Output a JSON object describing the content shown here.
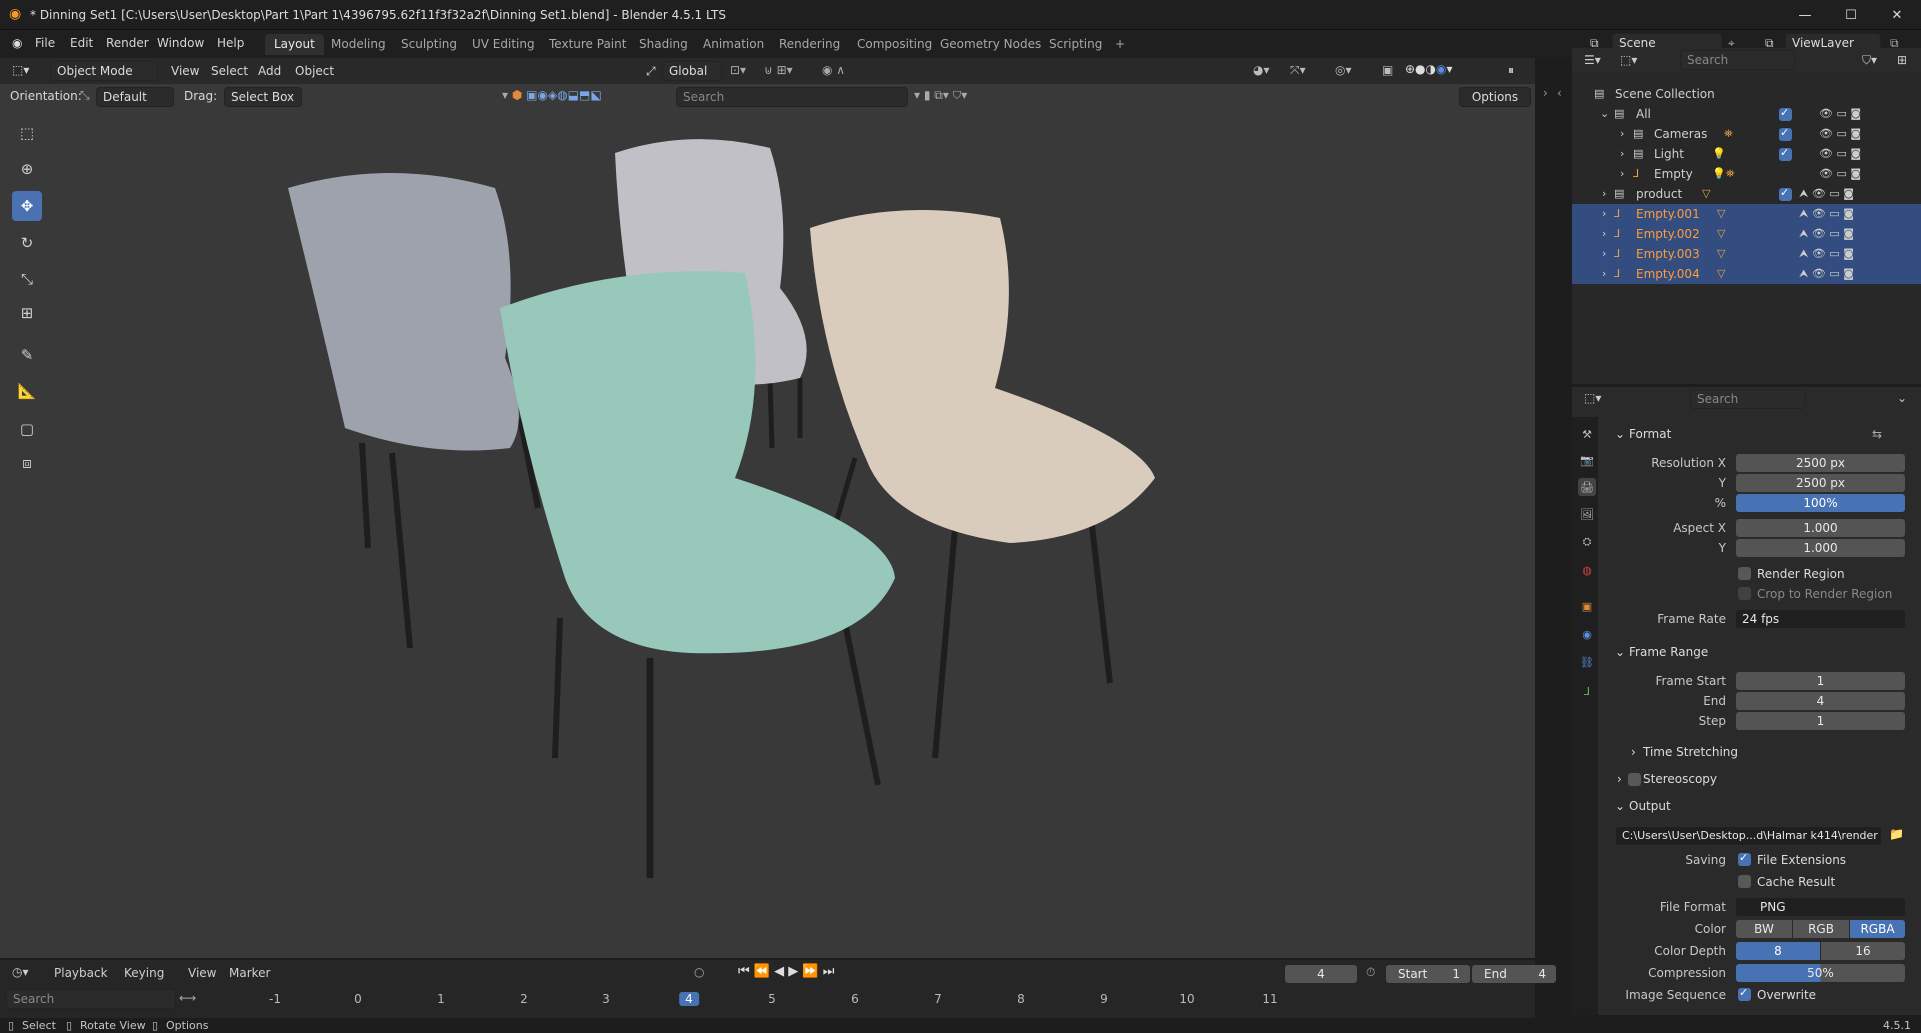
{
  "window": {
    "title": "* Dinning Set1 [C:\\Users\\User\\Desktop\\Part 1\\Part 1\\4396795.62f11f3f32a2f\\Dinning Set1.blend] - Blender 4.5.1 LTS",
    "minimize": "—",
    "maximize": "☐",
    "close": "✕"
  },
  "menu": [
    "File",
    "Edit",
    "Render",
    "Window",
    "Help"
  ],
  "workspaces": [
    "Layout",
    "Modeling",
    "Sculpting",
    "UV Editing",
    "Texture Paint",
    "Shading",
    "Animation",
    "Rendering",
    "Compositing",
    "Geometry Nodes",
    "Scripting",
    "+"
  ],
  "scene": {
    "label": "Scene",
    "view_layer": "ViewLayer"
  },
  "viewport": {
    "mode": "Object Mode",
    "menus": [
      "View",
      "Select",
      "Add",
      "Object"
    ],
    "transform_orientation": "Global",
    "orientation_label": "Orientation:",
    "orientation_value": "Default",
    "drag_label": "Drag:",
    "drag_value": "Select Box",
    "search_placeholder": "Search",
    "options": "Options"
  },
  "outliner": {
    "search_placeholder": "Search",
    "root": "Scene Collection",
    "items": [
      {
        "name": "All",
        "selected": false,
        "highlight": false
      },
      {
        "name": "Cameras",
        "selected": false,
        "highlight": false
      },
      {
        "name": "Light",
        "selected": false,
        "highlight": false
      },
      {
        "name": "Empty",
        "selected": false,
        "highlight": false
      },
      {
        "name": "product",
        "selected": false,
        "highlight": false
      },
      {
        "name": "Empty.001",
        "selected": true,
        "highlight": true
      },
      {
        "name": "Empty.002",
        "selected": true,
        "highlight": true
      },
      {
        "name": "Empty.003",
        "selected": true,
        "highlight": true
      },
      {
        "name": "Empty.004",
        "selected": true,
        "highlight": true
      }
    ]
  },
  "properties": {
    "search_placeholder": "Search",
    "format": {
      "title": "Format",
      "res_x_label": "Resolution X",
      "res_x": "2500 px",
      "res_y_label": "Y",
      "res_y": "2500 px",
      "pct_label": "%",
      "pct": "100%",
      "aspect_x_label": "Aspect X",
      "aspect_x": "1.000",
      "aspect_y_label": "Y",
      "aspect_y": "1.000",
      "render_region": "Render Region",
      "crop": "Crop to Render Region",
      "frame_rate_label": "Frame Rate",
      "frame_rate": "24 fps"
    },
    "frame_range": {
      "title": "Frame Range",
      "start_label": "Frame Start",
      "start": "1",
      "end_label": "End",
      "end": "4",
      "step_label": "Step",
      "step": "1",
      "time_stretching": "Time Stretching"
    },
    "stereoscopy": "Stereoscopy",
    "output": {
      "title": "Output",
      "path": "C:\\Users\\User\\Desktop...d\\Halmar k414\\render",
      "saving_label": "Saving",
      "file_extensions": "File Extensions",
      "cache_result": "Cache Result",
      "file_format_label": "File Format",
      "file_format": "PNG",
      "color_label": "Color",
      "color_options": [
        "BW",
        "RGB",
        "RGBA"
      ],
      "depth_label": "Color Depth",
      "depth_options": [
        "8",
        "16"
      ],
      "compression_label": "Compression",
      "compression": "50%",
      "image_sequence_label": "Image Sequence",
      "overwrite": "Overwrite"
    }
  },
  "timeline": {
    "menus": [
      "Playback",
      "Keying",
      "View",
      "Marker"
    ],
    "current_frame": "4",
    "start_label": "Start",
    "start": "1",
    "end_label": "End",
    "end": "4",
    "search_placeholder": "Search",
    "ticks": [
      "-1",
      "0",
      "1",
      "2",
      "3",
      "4",
      "5",
      "6",
      "7",
      "8",
      "9",
      "10",
      "11"
    ]
  },
  "statusbar": {
    "select": "Select",
    "rotate": "Rotate View",
    "options": "Options",
    "version": "4.5.1"
  },
  "chair_colors": {
    "back_left": "#9aa0ab",
    "back_middle": "#c2c2c8",
    "front": "#98c7b9",
    "right": "#d8cbbb"
  }
}
